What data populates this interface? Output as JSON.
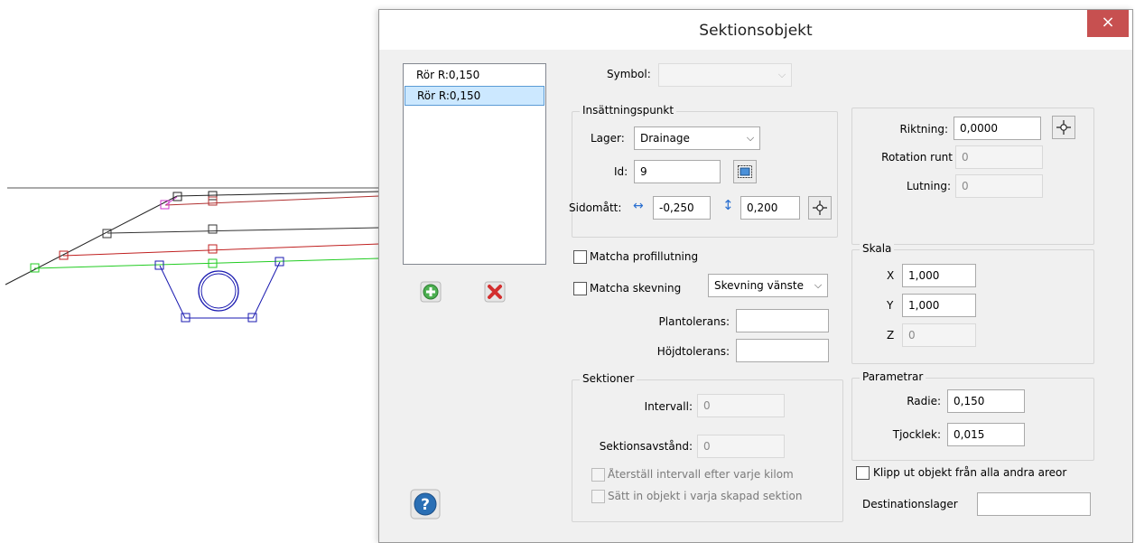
{
  "dialog": {
    "title": "Sektionsobjekt",
    "close_label": "×",
    "list_items": [
      {
        "label": "Rör R:0,150",
        "selected": false
      },
      {
        "label": "Rör R:0,150",
        "selected": true
      }
    ],
    "symbol": {
      "label": "Symbol:",
      "value": ""
    },
    "insattningspunkt": {
      "title": "Insättningspunkt",
      "lager_label": "Lager:",
      "lager_value": "Drainage",
      "id_label": "Id:",
      "id_value": "9",
      "sidomatt_label": "Sidomått:",
      "sidomatt_horizontal": "-0,250",
      "sidomatt_vertical": "0,200"
    },
    "riktning": {
      "riktning_label": "Riktning:",
      "riktning_value": "0,0000",
      "rotation_label": "Rotation runt",
      "rotation_value": "0",
      "lutning_label": "Lutning:",
      "lutning_value": "0"
    },
    "matcha_profillutning": {
      "label": "Matcha profillutning",
      "checked": false
    },
    "matcha_skevning": {
      "label": "Matcha skevning",
      "checked": false,
      "dropdown_value": "Skevning vänste"
    },
    "plantolerans": {
      "label": "Plantolerans:",
      "value": ""
    },
    "hojdtolerans": {
      "label": "Höjdtolerans:",
      "value": ""
    },
    "skala": {
      "title": "Skala",
      "x_label": "X",
      "x_value": "1,000",
      "y_label": "Y",
      "y_value": "1,000",
      "z_label": "Z",
      "z_value": "0"
    },
    "sektioner": {
      "title": "Sektioner",
      "intervall_label": "Intervall:",
      "intervall_value": "0",
      "sektionsavstand_label": "Sektionsavstånd:",
      "sektionsavstand_value": "0",
      "aterstall_label": "Återställ intervall efter varje kilom",
      "satt_in_label": "Sätt in objekt i varja skapad sektion"
    },
    "parametrar": {
      "title": "Parametrar",
      "radie_label": "Radie:",
      "radie_value": "0,150",
      "tjocklek_label": "Tjocklek:",
      "tjocklek_value": "0,015"
    },
    "klipp_ut": {
      "label": "Klipp ut objekt från alla andra areor",
      "checked": false
    },
    "destinationslager": {
      "label": "Destinationslager",
      "value": ""
    },
    "icons": {
      "add": "add-icon",
      "delete": "delete-icon",
      "help": "help-icon",
      "pick": "crosshair-icon",
      "select_id": "select-object-icon",
      "horizontal": "horizontal-arrow-icon",
      "vertical": "vertical-arrow-icon"
    }
  },
  "colors": {
    "close_button": "#c75050",
    "add_icon": "#4caf50",
    "delete_icon": "#d32f2f",
    "help_icon": "#2a6fb5",
    "selection": "#cce8ff",
    "cad_green": "#22cc22",
    "cad_red": "#c02020",
    "cad_blue": "#1a1ab0",
    "cad_magenta": "#cc33cc"
  }
}
